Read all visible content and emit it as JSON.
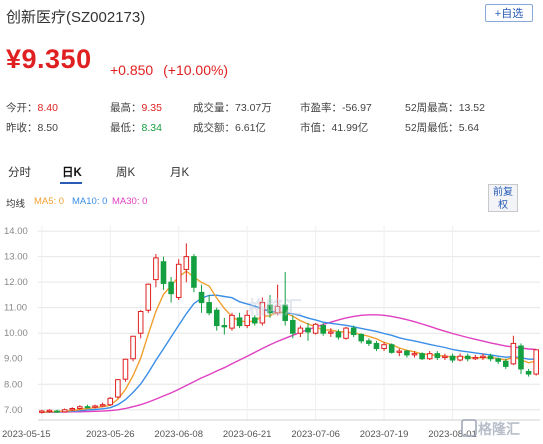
{
  "header": {
    "title": "创新医疗(SZ002173)",
    "add_label": "+自选"
  },
  "quote": {
    "price": "¥9.350",
    "change": "+0.850",
    "change_pct": "(+10.00%)"
  },
  "stats": [
    {
      "label": "今开：",
      "value": "8.40",
      "tone": "red"
    },
    {
      "label": "最高：",
      "value": "9.35",
      "tone": "red"
    },
    {
      "label": "成交量：",
      "value": "73.07万",
      "tone": "plain"
    },
    {
      "label": "市盈率：",
      "value": "-56.97",
      "tone": "plain"
    },
    {
      "label": "52周最高：",
      "value": "13.52",
      "tone": "plain"
    },
    {
      "label": "昨收：",
      "value": "8.50",
      "tone": "plain"
    },
    {
      "label": "最低：",
      "value": "8.34",
      "tone": "green"
    },
    {
      "label": "成交额：",
      "value": "6.61亿",
      "tone": "plain"
    },
    {
      "label": "市值：",
      "value": "41.99亿",
      "tone": "plain"
    },
    {
      "label": "52周最低：",
      "value": "5.64",
      "tone": "plain"
    }
  ],
  "tabs": [
    "分时",
    "日K",
    "周K",
    "月K"
  ],
  "active_tab": "日K",
  "legend": {
    "prefix": "均线",
    "ma5": "MA5: 0",
    "ma10": "MA10: 0",
    "ma30": "MA30: 0"
  },
  "adjust_button": {
    "line1": "前复",
    "line2": "权"
  },
  "watermark": "格隆汇",
  "colors": {
    "up": "#e02020",
    "down": "#14a040",
    "ma5": "#f0a030",
    "ma10": "#3a8ee6",
    "ma30": "#e040c0",
    "accent": "#2a5cb5"
  },
  "chart_data": {
    "type": "candlestick",
    "y_ticks": [
      "14.00",
      "13.00",
      "12.00",
      "11.00",
      "10.00",
      "9.00",
      "8.00",
      "7.00"
    ],
    "ylim": [
      6.6,
      14.2
    ],
    "x_ticks": [
      "2023-05-15",
      "2023-05-26",
      "2023-06-08",
      "2023-06-21",
      "2023-07-06",
      "2023-07-19",
      "2023-08-01"
    ],
    "x_tick_index": [
      0,
      9,
      18,
      27,
      36,
      45,
      54
    ],
    "grid": true,
    "candles": [
      [
        6.9,
        6.95,
        6.85,
        7.0
      ],
      [
        6.93,
        6.98,
        6.88,
        7.02
      ],
      [
        6.95,
        6.92,
        6.88,
        7.0
      ],
      [
        6.92,
        7.0,
        6.9,
        7.05
      ],
      [
        7.0,
        7.05,
        6.95,
        7.1
      ],
      [
        7.05,
        7.12,
        7.0,
        7.18
      ],
      [
        7.12,
        7.1,
        7.05,
        7.2
      ],
      [
        7.1,
        7.15,
        7.05,
        7.2
      ],
      [
        7.15,
        7.2,
        7.1,
        7.28
      ],
      [
        7.2,
        7.45,
        7.15,
        7.5
      ],
      [
        7.5,
        8.18,
        7.45,
        8.2
      ],
      [
        8.2,
        8.98,
        8.1,
        9.0
      ],
      [
        9.0,
        9.88,
        8.9,
        9.9
      ],
      [
        10.0,
        10.85,
        9.8,
        10.9
      ],
      [
        10.9,
        11.92,
        10.8,
        11.95
      ],
      [
        12.1,
        12.95,
        11.8,
        13.1
      ],
      [
        12.8,
        11.95,
        11.7,
        13.0
      ],
      [
        12.0,
        11.55,
        11.2,
        12.2
      ],
      [
        11.4,
        12.7,
        11.3,
        12.9
      ],
      [
        12.5,
        13.0,
        12.0,
        13.52
      ],
      [
        13.0,
        11.8,
        11.6,
        13.1
      ],
      [
        11.6,
        11.2,
        10.8,
        11.9
      ],
      [
        11.2,
        10.8,
        10.7,
        11.5
      ],
      [
        10.9,
        10.3,
        10.1,
        11.0
      ],
      [
        10.3,
        10.25,
        9.95,
        10.6
      ],
      [
        10.2,
        10.7,
        10.1,
        10.8
      ],
      [
        10.6,
        10.3,
        10.2,
        10.8
      ],
      [
        10.3,
        10.7,
        10.2,
        10.9
      ],
      [
        10.6,
        10.4,
        10.3,
        10.7
      ],
      [
        10.4,
        11.2,
        10.3,
        11.4
      ],
      [
        11.1,
        10.8,
        10.6,
        11.5
      ],
      [
        10.8,
        11.05,
        10.7,
        11.9
      ],
      [
        11.1,
        10.5,
        10.3,
        12.4
      ],
      [
        10.5,
        10.0,
        9.8,
        10.7
      ],
      [
        10.0,
        10.2,
        9.85,
        10.3
      ],
      [
        10.2,
        10.05,
        9.7,
        10.4
      ],
      [
        10.0,
        10.35,
        9.95,
        10.4
      ],
      [
        10.3,
        10.0,
        9.9,
        10.4
      ],
      [
        10.0,
        10.05,
        9.85,
        10.2
      ],
      [
        10.05,
        9.85,
        9.75,
        10.15
      ],
      [
        9.8,
        10.2,
        9.75,
        10.25
      ],
      [
        10.2,
        9.95,
        9.85,
        10.3
      ],
      [
        9.95,
        9.7,
        9.6,
        10.0
      ],
      [
        9.7,
        9.6,
        9.5,
        9.8
      ],
      [
        9.6,
        9.4,
        9.3,
        9.7
      ],
      [
        9.4,
        9.55,
        9.3,
        9.65
      ],
      [
        9.55,
        9.25,
        9.2,
        9.6
      ],
      [
        9.25,
        9.3,
        9.1,
        9.4
      ],
      [
        9.3,
        9.15,
        9.05,
        9.35
      ],
      [
        9.15,
        9.2,
        9.05,
        9.3
      ],
      [
        9.2,
        9.0,
        8.95,
        9.25
      ],
      [
        9.0,
        9.2,
        8.95,
        9.3
      ],
      [
        9.2,
        9.05,
        8.95,
        9.3
      ],
      [
        9.05,
        9.1,
        8.95,
        9.2
      ],
      [
        9.1,
        8.95,
        8.85,
        9.2
      ],
      [
        8.95,
        9.1,
        8.9,
        9.2
      ],
      [
        9.1,
        9.0,
        8.9,
        9.2
      ],
      [
        9.0,
        9.05,
        8.95,
        9.15
      ],
      [
        9.05,
        9.1,
        8.95,
        9.2
      ],
      [
        9.1,
        9.0,
        8.9,
        9.2
      ],
      [
        9.0,
        8.9,
        8.8,
        9.05
      ],
      [
        8.9,
        8.7,
        8.6,
        9.0
      ],
      [
        8.8,
        9.6,
        8.75,
        9.9
      ],
      [
        9.5,
        8.6,
        8.4,
        9.6
      ],
      [
        8.5,
        8.4,
        8.3,
        8.6
      ],
      [
        8.4,
        9.35,
        8.34,
        9.35
      ]
    ],
    "ma5": [
      6.9,
      6.92,
      6.93,
      6.95,
      6.97,
      7.01,
      7.05,
      7.08,
      7.12,
      7.18,
      7.42,
      7.8,
      8.34,
      9.02,
      9.96,
      10.86,
      11.52,
      11.86,
      12.21,
      12.43,
      12.2,
      11.99,
      11.85,
      11.38,
      10.97,
      10.65,
      10.47,
      10.45,
      10.47,
      10.68,
      10.68,
      10.85,
      10.79,
      10.67,
      10.49,
      10.36,
      10.25,
      10.12,
      10.13,
      10.06,
      10.05,
      10.01,
      9.95,
      9.88,
      9.78,
      9.64,
      9.55,
      9.42,
      9.33,
      9.27,
      9.18,
      9.17,
      9.12,
      9.11,
      9.06,
      9.08,
      9.04,
      9.04,
      9.05,
      9.04,
      9.01,
      8.95,
      9.07,
      8.96,
      8.84,
      8.91
    ],
    "ma10": [
      6.9,
      6.91,
      6.92,
      6.93,
      6.94,
      6.96,
      6.99,
      7.01,
      7.04,
      7.08,
      7.2,
      7.4,
      7.68,
      8.01,
      8.45,
      8.94,
      9.39,
      9.85,
      10.31,
      10.76,
      11.16,
      11.37,
      11.48,
      11.49,
      11.44,
      11.39,
      11.23,
      11.15,
      11.06,
      10.96,
      10.85,
      10.83,
      10.8,
      10.76,
      10.69,
      10.59,
      10.52,
      10.43,
      10.39,
      10.35,
      10.31,
      10.25,
      10.19,
      10.13,
      10.07,
      9.99,
      9.92,
      9.82,
      9.75,
      9.7,
      9.63,
      9.56,
      9.5,
      9.44,
      9.36,
      9.31,
      9.27,
      9.23,
      9.19,
      9.15,
      9.1,
      9.06,
      9.08,
      9.04,
      8.98,
      8.98
    ],
    "ma30": [
      6.9,
      6.9,
      6.91,
      6.91,
      6.92,
      6.92,
      6.93,
      6.94,
      6.95,
      6.97,
      7.0,
      7.05,
      7.12,
      7.2,
      7.3,
      7.42,
      7.54,
      7.66,
      7.8,
      7.95,
      8.1,
      8.25,
      8.38,
      8.52,
      8.65,
      8.8,
      8.95,
      9.1,
      9.25,
      9.4,
      9.55,
      9.68,
      9.8,
      9.92,
      10.03,
      10.14,
      10.24,
      10.34,
      10.43,
      10.52,
      10.6,
      10.66,
      10.7,
      10.72,
      10.72,
      10.7,
      10.66,
      10.6,
      10.53,
      10.45,
      10.36,
      10.27,
      10.17,
      10.08,
      9.99,
      9.91,
      9.83,
      9.76,
      9.69,
      9.62,
      9.56,
      9.5,
      9.46,
      9.42,
      9.38,
      9.36
    ]
  }
}
